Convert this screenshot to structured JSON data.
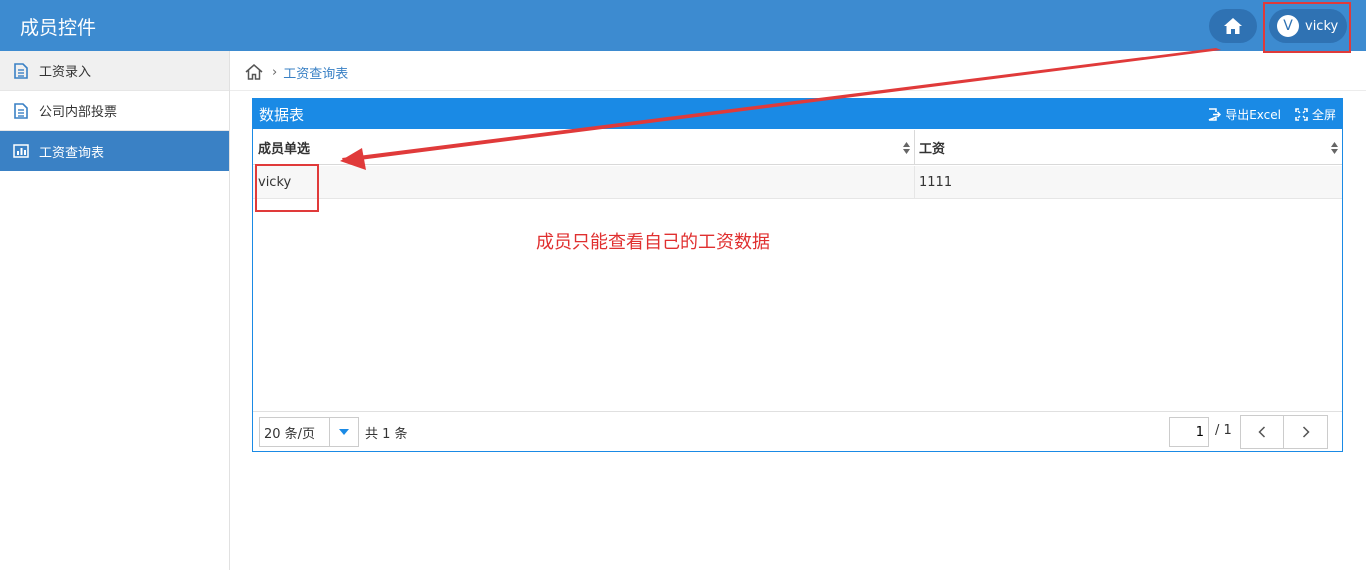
{
  "header": {
    "app_title": "成员控件",
    "user_initial": "V",
    "user_name": "vicky"
  },
  "sidebar": {
    "items": [
      {
        "label": "工资录入",
        "icon": "document-icon"
      },
      {
        "label": "公司内部投票",
        "icon": "document-icon"
      },
      {
        "label": "工资查询表",
        "icon": "report-icon",
        "active": true
      }
    ]
  },
  "breadcrumb": {
    "current": "工资查询表"
  },
  "panel": {
    "title": "数据表",
    "export_label": "导出Excel",
    "fullscreen_label": "全屏"
  },
  "table": {
    "columns": [
      "成员单选",
      "工资"
    ],
    "rows": [
      [
        "vicky",
        "1111"
      ]
    ]
  },
  "annotation": {
    "note": "成员只能查看自己的工资数据",
    "color": "#e03030"
  },
  "pager": {
    "page_size": "20 条/页",
    "total": "共 1 条",
    "current_page": "1",
    "page_count": "/ 1"
  },
  "colors": {
    "topbar": "#3d8bd0",
    "accent": "#1a8ae5",
    "active_nav": "#3a81c5"
  }
}
